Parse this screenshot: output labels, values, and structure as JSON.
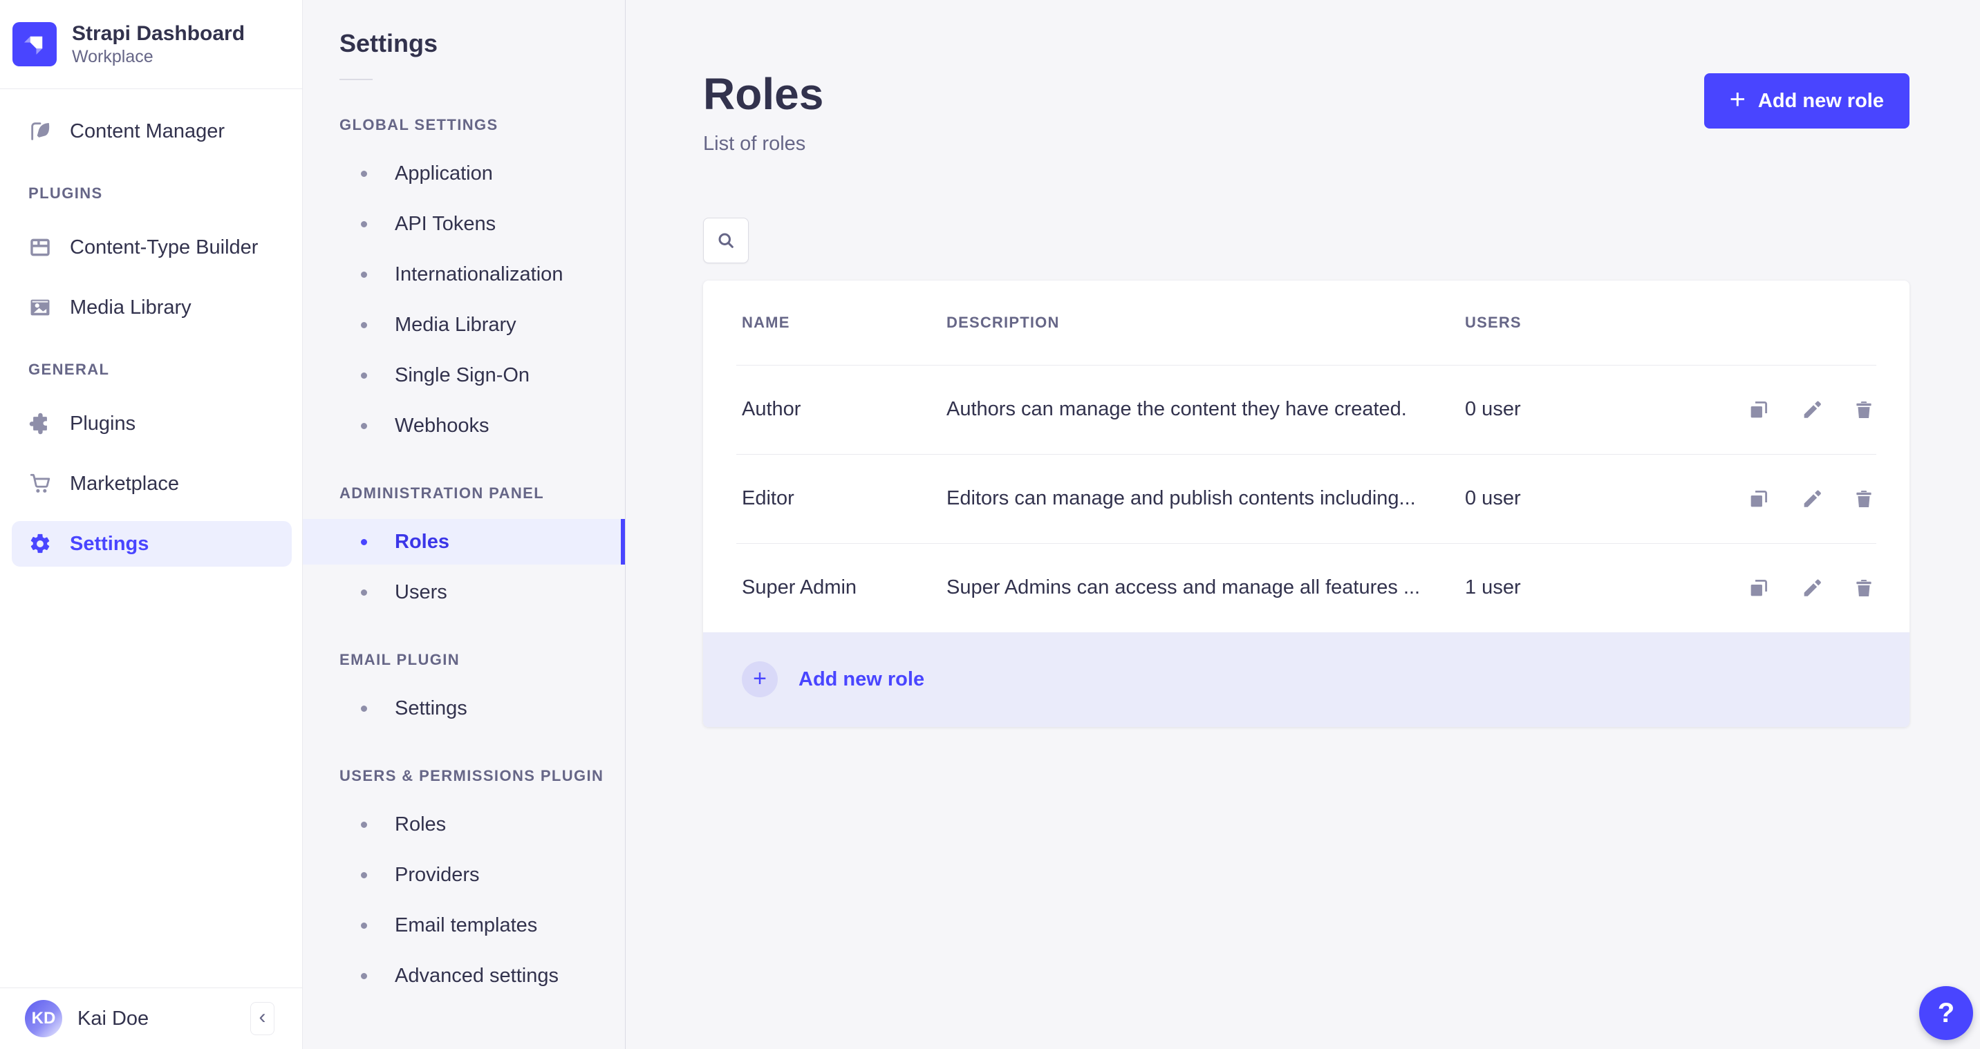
{
  "colors": {
    "accent": "#4945FF",
    "accent_bg": "#EDEFFE",
    "text_dark": "#32324D",
    "text_gray": "#666687",
    "icon_gray": "#8E8EA9",
    "page_bg": "#F6F6F9",
    "card_bg": "#FFFFFF",
    "footer_row_bg": "#EAEBFA"
  },
  "brand": {
    "title": "Strapi Dashboard",
    "subtitle": "Workplace"
  },
  "sidebar": {
    "top_items": [
      {
        "label": "Content Manager",
        "icon": "feather-icon"
      }
    ],
    "sections": [
      {
        "label": "PLUGINS",
        "items": [
          {
            "label": "Content-Type Builder",
            "icon": "layout-icon"
          },
          {
            "label": "Media Library",
            "icon": "image-icon"
          }
        ]
      },
      {
        "label": "GENERAL",
        "items": [
          {
            "label": "Plugins",
            "icon": "puzzle-icon"
          },
          {
            "label": "Marketplace",
            "icon": "cart-icon"
          },
          {
            "label": "Settings",
            "icon": "gear-icon",
            "active": true
          }
        ]
      }
    ],
    "user": {
      "name": "Kai Doe",
      "initials": "KD"
    },
    "collapse_glyph": "‹"
  },
  "subnav": {
    "title": "Settings",
    "sections": [
      {
        "label": "GLOBAL SETTINGS",
        "items": [
          "Application",
          "API Tokens",
          "Internationalization",
          "Media Library",
          "Single Sign-On",
          "Webhooks"
        ]
      },
      {
        "label": "ADMINISTRATION PANEL",
        "items": [
          "Roles",
          "Users"
        ],
        "active_item": "Roles"
      },
      {
        "label": "EMAIL PLUGIN",
        "items": [
          "Settings"
        ]
      },
      {
        "label": "USERS & PERMISSIONS PLUGIN",
        "items": [
          "Roles",
          "Providers",
          "Email templates",
          "Advanced settings"
        ]
      }
    ]
  },
  "main": {
    "title": "Roles",
    "subtitle": "List of roles",
    "add_button_label": "Add new role",
    "plus_glyph": "+",
    "table": {
      "headers": [
        "NAME",
        "DESCRIPTION",
        "USERS"
      ],
      "rows": [
        {
          "name": "Author",
          "description": "Authors can manage the content they have created.",
          "users": "0 user"
        },
        {
          "name": "Editor",
          "description": "Editors can manage and publish contents including...",
          "users": "0 user"
        },
        {
          "name": "Super Admin",
          "description": "Super Admins can access and manage all features ...",
          "users": "1 user"
        }
      ],
      "footer_add_label": "Add new role"
    },
    "help_glyph": "?"
  }
}
